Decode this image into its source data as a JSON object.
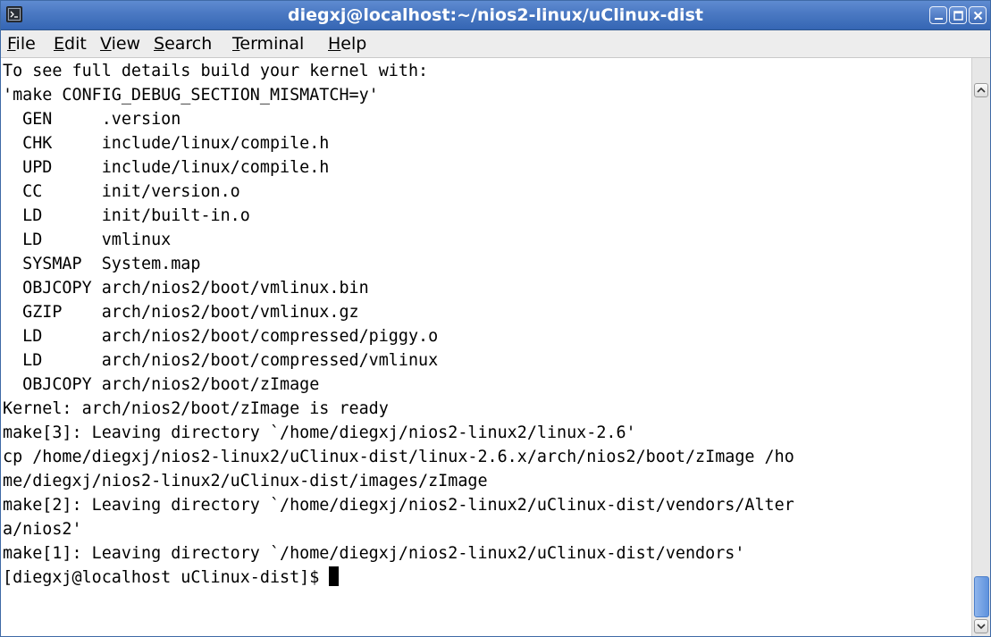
{
  "window": {
    "title": "diegxj@localhost:~/nios2-linux/uClinux-dist"
  },
  "menu": [
    {
      "label": "File",
      "mnemonic": "F",
      "rest": "ile"
    },
    {
      "label": "Edit",
      "mnemonic": "E",
      "rest": "dit"
    },
    {
      "label": "View",
      "mnemonic": "V",
      "rest": "iew"
    },
    {
      "label": "Search",
      "mnemonic": "S",
      "rest": "earch"
    },
    {
      "label": "Terminal",
      "mnemonic": "T",
      "rest": "erminal"
    },
    {
      "label": "Help",
      "mnemonic": "H",
      "rest": "elp"
    }
  ],
  "terminal": {
    "lines": [
      "To see full details build your kernel with:",
      "'make CONFIG_DEBUG_SECTION_MISMATCH=y'",
      "  GEN     .version",
      "  CHK     include/linux/compile.h",
      "  UPD     include/linux/compile.h",
      "  CC      init/version.o",
      "  LD      init/built-in.o",
      "  LD      vmlinux",
      "  SYSMAP  System.map",
      "  OBJCOPY arch/nios2/boot/vmlinux.bin",
      "  GZIP    arch/nios2/boot/vmlinux.gz",
      "  LD      arch/nios2/boot/compressed/piggy.o",
      "  LD      arch/nios2/boot/compressed/vmlinux",
      "  OBJCOPY arch/nios2/boot/zImage",
      "Kernel: arch/nios2/boot/zImage is ready",
      "make[3]: Leaving directory `/home/diegxj/nios2-linux2/linux-2.6'",
      "cp /home/diegxj/nios2-linux2/uClinux-dist/linux-2.6.x/arch/nios2/boot/zImage /ho",
      "me/diegxj/nios2-linux2/uClinux-dist/images/zImage",
      "make[2]: Leaving directory `/home/diegxj/nios2-linux2/uClinux-dist/vendors/Alter",
      "a/nios2'",
      "make[1]: Leaving directory `/home/diegxj/nios2-linux2/uClinux-dist/vendors'"
    ],
    "prompt": "[diegxj@localhost uClinux-dist]$ "
  },
  "icons": {
    "app": "terminal-icon",
    "minimize": "minimize-icon",
    "maximize": "maximize-icon",
    "close": "close-icon",
    "scroll_up": "arrow-up-icon",
    "scroll_down": "arrow-down-icon"
  },
  "colors": {
    "titlebar": "#4a78c2",
    "menubar": "#ededed",
    "terminal_bg": "#ffffff",
    "terminal_fg": "#000000",
    "scroll_thumb": "#6f9de2"
  }
}
